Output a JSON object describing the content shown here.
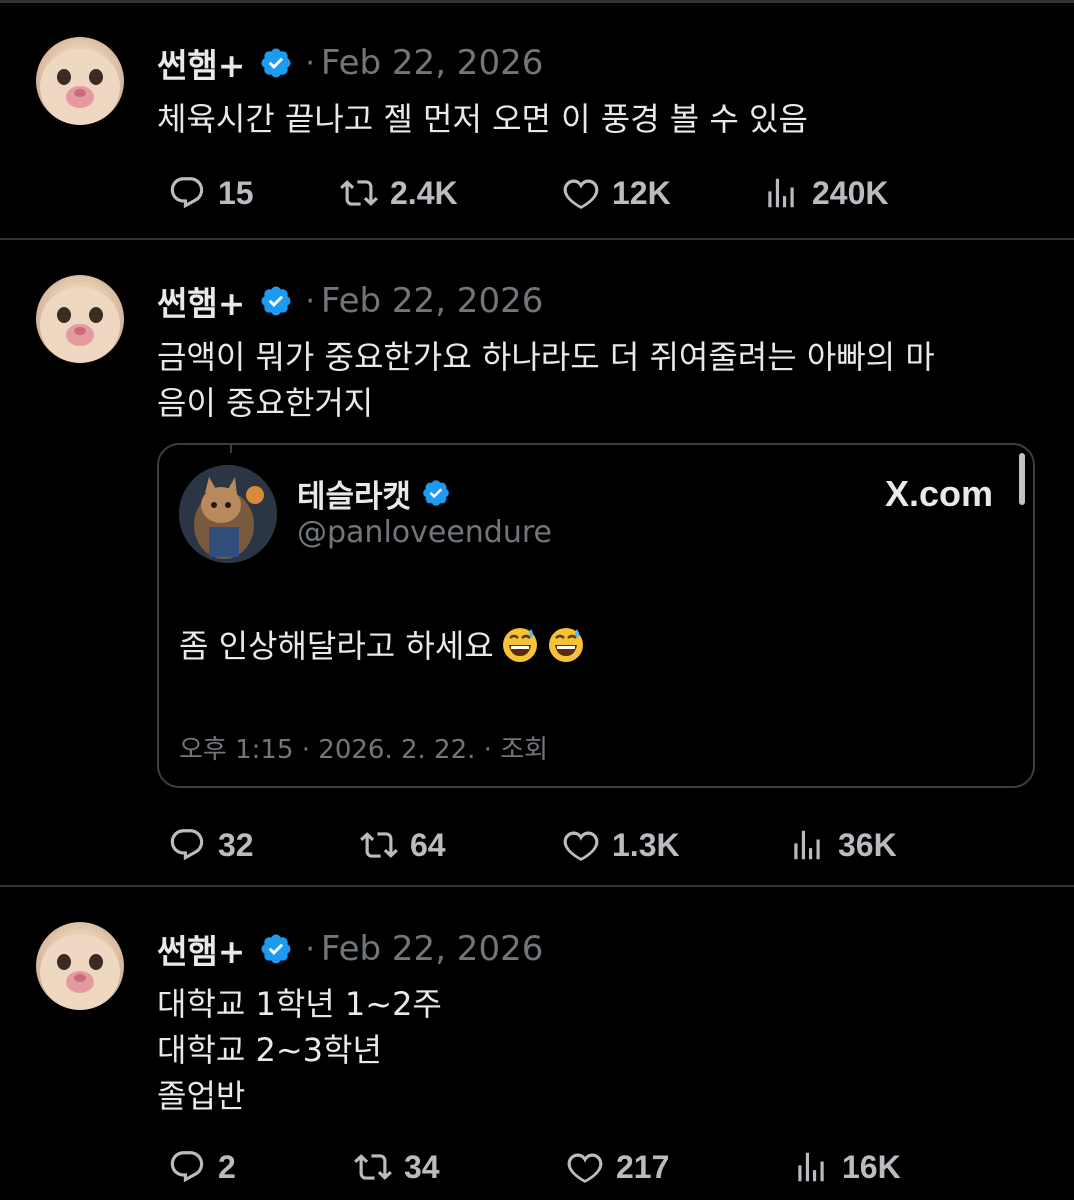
{
  "tweets": [
    {
      "author": "썬햄+",
      "dot": "·",
      "date": "Feb 22, 2026",
      "text_lines": [
        "체육시간 끝나고 젤 먼저 오면 이 풍경 볼 수 있음"
      ],
      "replies": "15",
      "reposts": "2.4K",
      "likes": "12K",
      "views": "240K"
    },
    {
      "author": "썬햄+",
      "dot": "·",
      "date": "Feb 22, 2026",
      "text_lines": [
        "금액이 뭐가 중요한가요 하나라도 더 쥐여줄려는 아빠의 마",
        "음이 중요한거지"
      ],
      "replies": "32",
      "reposts": "64",
      "likes": "1.3K",
      "views": "36K",
      "quote": {
        "name": "테슬라캣",
        "handle": "@panloveendure",
        "brand": "X.com",
        "text": "좀 인상해달라고 하세요",
        "emojis": [
          "grinning-sweat-emoji",
          "grinning-sweat-emoji"
        ],
        "meta": "오후 1:15 · 2026. 2. 22. · 조회"
      }
    },
    {
      "author": "썬햄+",
      "dot": "·",
      "date": "Feb 22, 2026",
      "text_lines": [
        "대학교 1학년 1~2주",
        "대학교 2~3학년",
        "졸업반"
      ],
      "replies": "2",
      "reposts": "34",
      "likes": "217",
      "views": "16K"
    }
  ],
  "icons": {
    "reply": "reply-icon",
    "repost": "repost-icon",
    "like": "heart-icon",
    "views": "views-icon",
    "verified": "verified-badge-icon"
  },
  "colors": {
    "background": "#000000",
    "text": "#e7e9ea",
    "muted": "#71767b",
    "verified": "#1d9bf0",
    "divider": "#2f3336"
  }
}
